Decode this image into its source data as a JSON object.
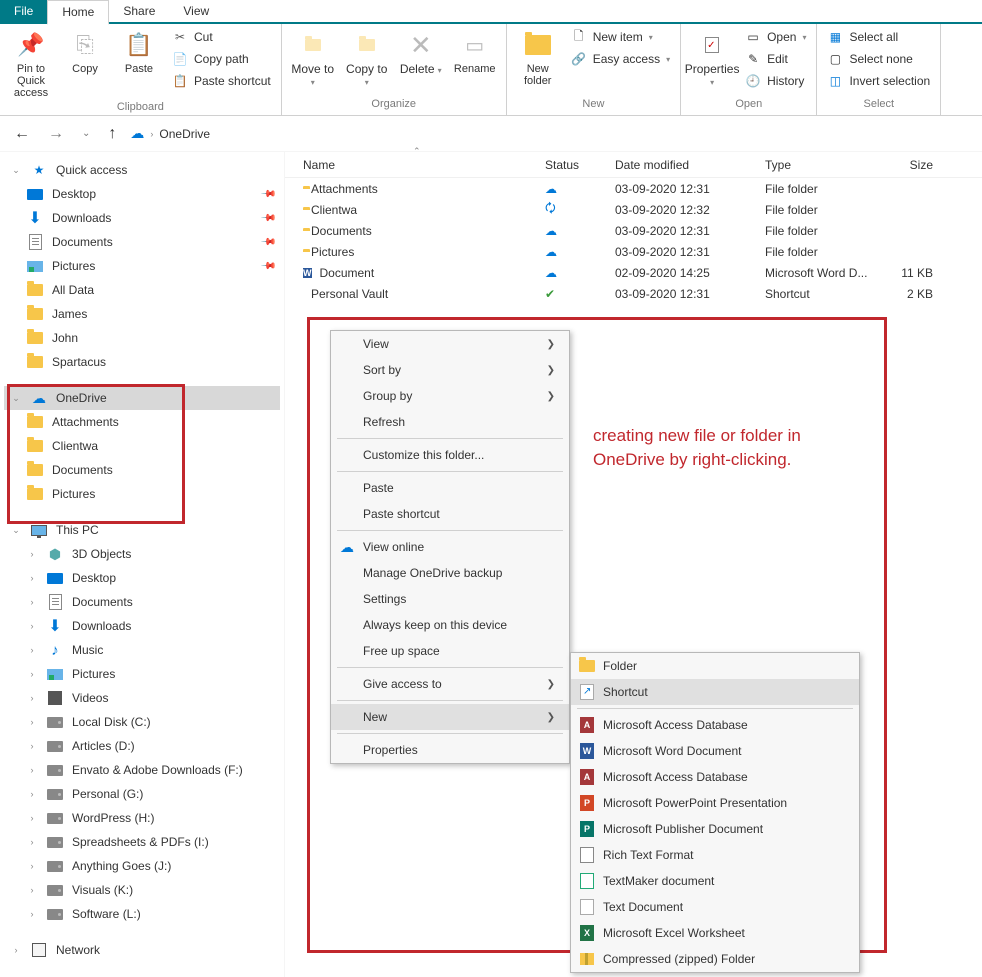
{
  "tabs": {
    "file": "File",
    "home": "Home",
    "share": "Share",
    "view": "View"
  },
  "ribbon": {
    "clipboard": {
      "label": "Clipboard",
      "pin": "Pin to Quick access",
      "copy": "Copy",
      "paste": "Paste",
      "cut": "Cut",
      "copy_path": "Copy path",
      "paste_shortcut": "Paste shortcut"
    },
    "organize": {
      "label": "Organize",
      "move_to": "Move to",
      "copy_to": "Copy to",
      "delete": "Delete",
      "rename": "Rename"
    },
    "new": {
      "label": "New",
      "new_folder": "New folder",
      "new_item": "New item",
      "easy_access": "Easy access"
    },
    "open": {
      "label": "Open",
      "properties": "Properties",
      "open": "Open",
      "edit": "Edit",
      "history": "History"
    },
    "select": {
      "label": "Select",
      "select_all": "Select all",
      "select_none": "Select none",
      "invert": "Invert selection"
    }
  },
  "breadcrumb": {
    "root": "OneDrive"
  },
  "nav": {
    "quick_access": "Quick access",
    "qa_items": [
      {
        "label": "Desktop",
        "icon": "desktop",
        "pin": true
      },
      {
        "label": "Downloads",
        "icon": "download",
        "pin": true
      },
      {
        "label": "Documents",
        "icon": "docfile",
        "pin": true
      },
      {
        "label": "Pictures",
        "icon": "pic",
        "pin": true
      },
      {
        "label": "All Data",
        "icon": "folder"
      },
      {
        "label": "James",
        "icon": "folder"
      },
      {
        "label": "John",
        "icon": "folder"
      },
      {
        "label": "Spartacus",
        "icon": "folder"
      }
    ],
    "onedrive": "OneDrive",
    "od_items": [
      {
        "label": "Attachments"
      },
      {
        "label": "Clientwa"
      },
      {
        "label": "Documents"
      },
      {
        "label": "Pictures"
      }
    ],
    "thispc": "This PC",
    "pc_items": [
      {
        "label": "3D Objects",
        "icon": "3d"
      },
      {
        "label": "Desktop",
        "icon": "desktop"
      },
      {
        "label": "Documents",
        "icon": "docfile"
      },
      {
        "label": "Downloads",
        "icon": "download"
      },
      {
        "label": "Music",
        "icon": "music"
      },
      {
        "label": "Pictures",
        "icon": "pic"
      },
      {
        "label": "Videos",
        "icon": "vid"
      },
      {
        "label": "Local Disk (C:)",
        "icon": "drive"
      },
      {
        "label": "Articles (D:)",
        "icon": "drive"
      },
      {
        "label": "Envato & Adobe Downloads (F:)",
        "icon": "drive"
      },
      {
        "label": "Personal (G:)",
        "icon": "drive"
      },
      {
        "label": "WordPress (H:)",
        "icon": "drive"
      },
      {
        "label": "Spreadsheets & PDFs (I:)",
        "icon": "drive"
      },
      {
        "label": "Anything Goes (J:)",
        "icon": "drive"
      },
      {
        "label": "Visuals (K:)",
        "icon": "drive"
      },
      {
        "label": "Software (L:)",
        "icon": "drive"
      }
    ],
    "network": "Network"
  },
  "cols": {
    "name": "Name",
    "status": "Status",
    "date": "Date modified",
    "type": "Type",
    "size": "Size"
  },
  "rows": [
    {
      "name": "Attachments",
      "icon": "folder",
      "status": "cloud",
      "date": "03-09-2020 12:31",
      "type": "File folder",
      "size": ""
    },
    {
      "name": "Clientwa",
      "icon": "folder",
      "status": "sync",
      "date": "03-09-2020 12:32",
      "type": "File folder",
      "size": ""
    },
    {
      "name": "Documents",
      "icon": "folder",
      "status": "cloud",
      "date": "03-09-2020 12:31",
      "type": "File folder",
      "size": ""
    },
    {
      "name": "Pictures",
      "icon": "folder",
      "status": "cloud",
      "date": "03-09-2020 12:31",
      "type": "File folder",
      "size": ""
    },
    {
      "name": "Document",
      "icon": "word",
      "status": "cloud",
      "date": "02-09-2020 14:25",
      "type": "Microsoft Word D...",
      "size": "11 KB"
    },
    {
      "name": "Personal Vault",
      "icon": "vault",
      "status": "ok",
      "date": "03-09-2020 12:31",
      "type": "Shortcut",
      "size": "2 KB"
    }
  ],
  "ctx": {
    "view": "View",
    "sort_by": "Sort by",
    "group_by": "Group by",
    "refresh": "Refresh",
    "customize": "Customize this folder...",
    "paste": "Paste",
    "paste_shortcut": "Paste shortcut",
    "view_online": "View online",
    "manage_backup": "Manage OneDrive backup",
    "settings": "Settings",
    "always_keep": "Always keep on this device",
    "free_up": "Free up space",
    "give_access": "Give access to",
    "new": "New",
    "properties": "Properties"
  },
  "sub": {
    "folder": "Folder",
    "shortcut": "Shortcut",
    "access_db": "Microsoft Access Database",
    "word_doc": "Microsoft Word Document",
    "access_db2": "Microsoft Access Database",
    "ppt": "Microsoft PowerPoint Presentation",
    "publisher": "Microsoft Publisher Document",
    "rtf": "Rich Text Format",
    "textmaker": "TextMaker document",
    "txt": "Text Document",
    "excel": "Microsoft Excel Worksheet",
    "zip": "Compressed (zipped) Folder"
  },
  "annotation": "creating new file or folder in OneDrive by right-clicking."
}
